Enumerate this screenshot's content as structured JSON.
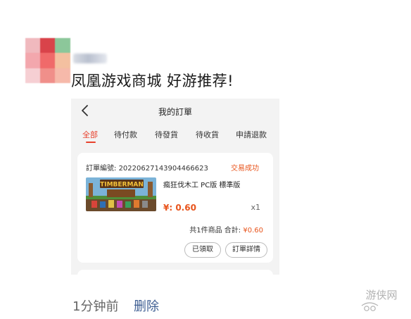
{
  "post": {
    "text": "凤凰游戏商城 好游推荐!"
  },
  "screenshot": {
    "header": {
      "title": "我的訂單",
      "back_icon": "chevron-left-icon"
    },
    "tabs": [
      {
        "label": "全部",
        "active": true
      },
      {
        "label": "待付款",
        "active": false
      },
      {
        "label": "待發貨",
        "active": false
      },
      {
        "label": "待收貨",
        "active": false
      },
      {
        "label": "申請退款",
        "active": false
      }
    ],
    "order": {
      "number_label": "訂單編號:",
      "number": "20220627143904466623",
      "status": "交易成功",
      "product_image_text": "TIMBERMAN",
      "product_name": "瘋狂伐木工 PC版 標準版",
      "price": "¥: 0.60",
      "quantity": "x1",
      "summary_prefix": "共1件商品 合計:",
      "summary_total": "¥0.60",
      "buttons": {
        "claimed": "已領取",
        "detail": "訂單詳情"
      }
    }
  },
  "footer": {
    "time": "1分钟前",
    "delete": "删除"
  },
  "watermark": {
    "text": "游侠网"
  },
  "colors": {
    "accent": "#e8412c",
    "price": "#e8541c",
    "link": "#3f5f93",
    "screenshot_bg": "#f3f3f3"
  }
}
